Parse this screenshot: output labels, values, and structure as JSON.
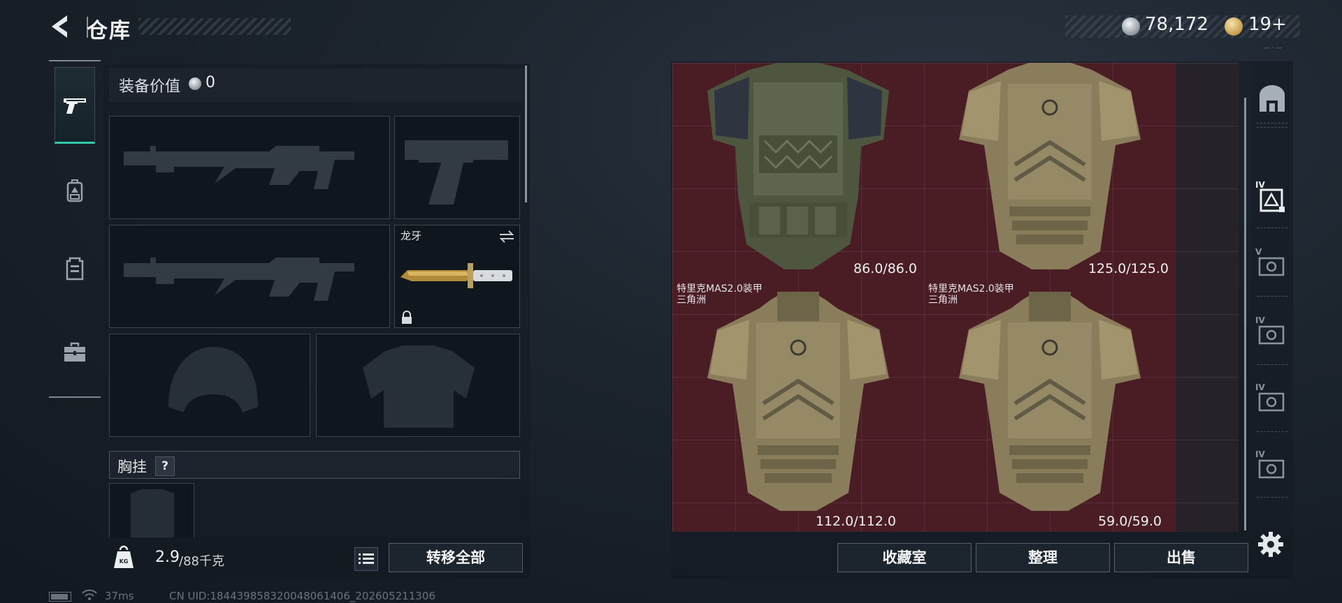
{
  "header": {
    "title": "仓库",
    "silver_value": "78,172",
    "gold_value": "19+"
  },
  "tabs": [
    {
      "icon": "pistol-icon",
      "active": true
    },
    {
      "icon": "backpack-icon",
      "active": false
    },
    {
      "icon": "vest-icon",
      "active": false
    },
    {
      "icon": "briefcase-icon",
      "active": false
    }
  ],
  "equipment": {
    "value_label": "装备价值",
    "value": "0",
    "melee_name": "龙牙",
    "chest_rig_label": "胸挂",
    "help_symbol": "?",
    "weight_current": "2.9",
    "weight_max": "/88千克",
    "transfer_all_label": "转移全部"
  },
  "stash": {
    "items": [
      {
        "name": "",
        "subname": "",
        "durability": "86.0/86.0"
      },
      {
        "name": "",
        "subname": "",
        "durability": "125.0/125.0"
      },
      {
        "name": "特里克MAS2.0装甲",
        "subname": "三角洲",
        "durability": "112.0/112.0"
      },
      {
        "name": "特里克MAS2.0装甲",
        "subname": "三角洲",
        "durability": "59.0/59.0"
      }
    ],
    "buttons": {
      "collection": "收藏室",
      "organize": "整理",
      "sell": "出售"
    }
  },
  "filters": [
    {
      "icon": "armor-all-icon",
      "tier": ""
    },
    {
      "icon": "armor-tier-iv-icon",
      "tier": "IV"
    },
    {
      "icon": "armor-tier-v-icon",
      "tier": "V"
    },
    {
      "icon": "armor-tier-iv-icon",
      "tier": "IV"
    },
    {
      "icon": "armor-tier-iv-icon",
      "tier": "IV"
    },
    {
      "icon": "armor-tier-iv-icon",
      "tier": "IV"
    }
  ],
  "status": {
    "ping": "37ms",
    "uid": "CN UID:18443985832004806140​6_202605211306"
  },
  "colors": {
    "accent": "#35c8a8",
    "stash_bg": "#4a1c24",
    "panel_bg": "#161c24"
  }
}
